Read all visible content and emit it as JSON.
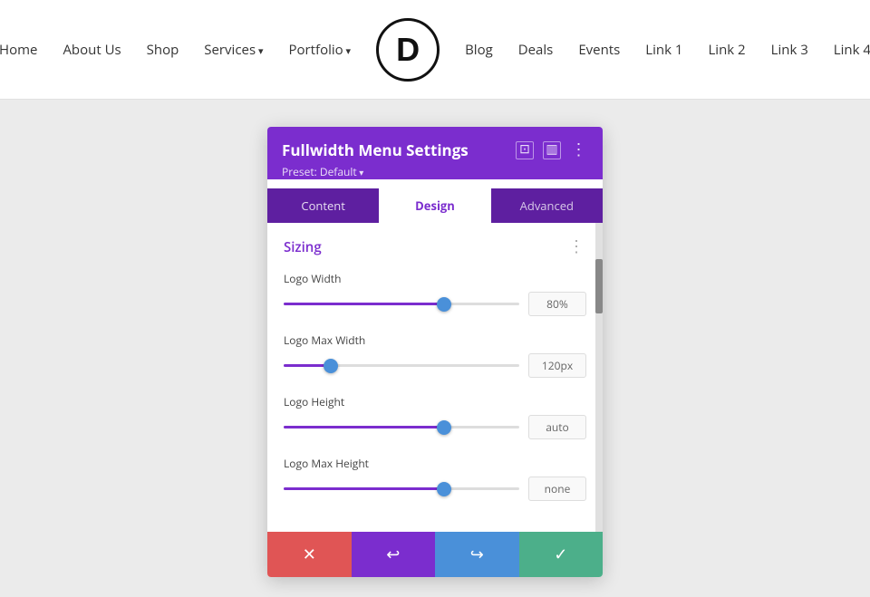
{
  "navbar": {
    "items": [
      {
        "label": "Home",
        "hasArrow": false
      },
      {
        "label": "About Us",
        "hasArrow": false
      },
      {
        "label": "Shop",
        "hasArrow": false
      },
      {
        "label": "Services",
        "hasArrow": true
      },
      {
        "label": "Portfolio",
        "hasArrow": true
      },
      {
        "label": "Blog",
        "hasArrow": false
      },
      {
        "label": "Deals",
        "hasArrow": false
      },
      {
        "label": "Events",
        "hasArrow": false
      },
      {
        "label": "Link 1",
        "hasArrow": false
      },
      {
        "label": "Link 2",
        "hasArrow": false
      },
      {
        "label": "Link 3",
        "hasArrow": false
      },
      {
        "label": "Link 4",
        "hasArrow": false
      }
    ],
    "logo_letter": "D"
  },
  "panel": {
    "title": "Fullwidth Menu Settings",
    "preset_label": "Preset: Default",
    "tabs": [
      {
        "label": "Content",
        "active": false
      },
      {
        "label": "Design",
        "active": true
      },
      {
        "label": "Advanced",
        "active": false
      }
    ],
    "section_title": "Sizing",
    "controls": [
      {
        "label": "Logo Width",
        "value": "80%",
        "thumb_pct": 68
      },
      {
        "label": "Logo Max Width",
        "value": "120px",
        "thumb_pct": 20
      },
      {
        "label": "Logo Height",
        "value": "auto",
        "thumb_pct": 68
      },
      {
        "label": "Logo Max Height",
        "value": "none",
        "thumb_pct": 68
      }
    ]
  },
  "action_bar": {
    "cancel_icon": "✕",
    "undo_icon": "↩",
    "redo_icon": "↪",
    "confirm_icon": "✓"
  }
}
